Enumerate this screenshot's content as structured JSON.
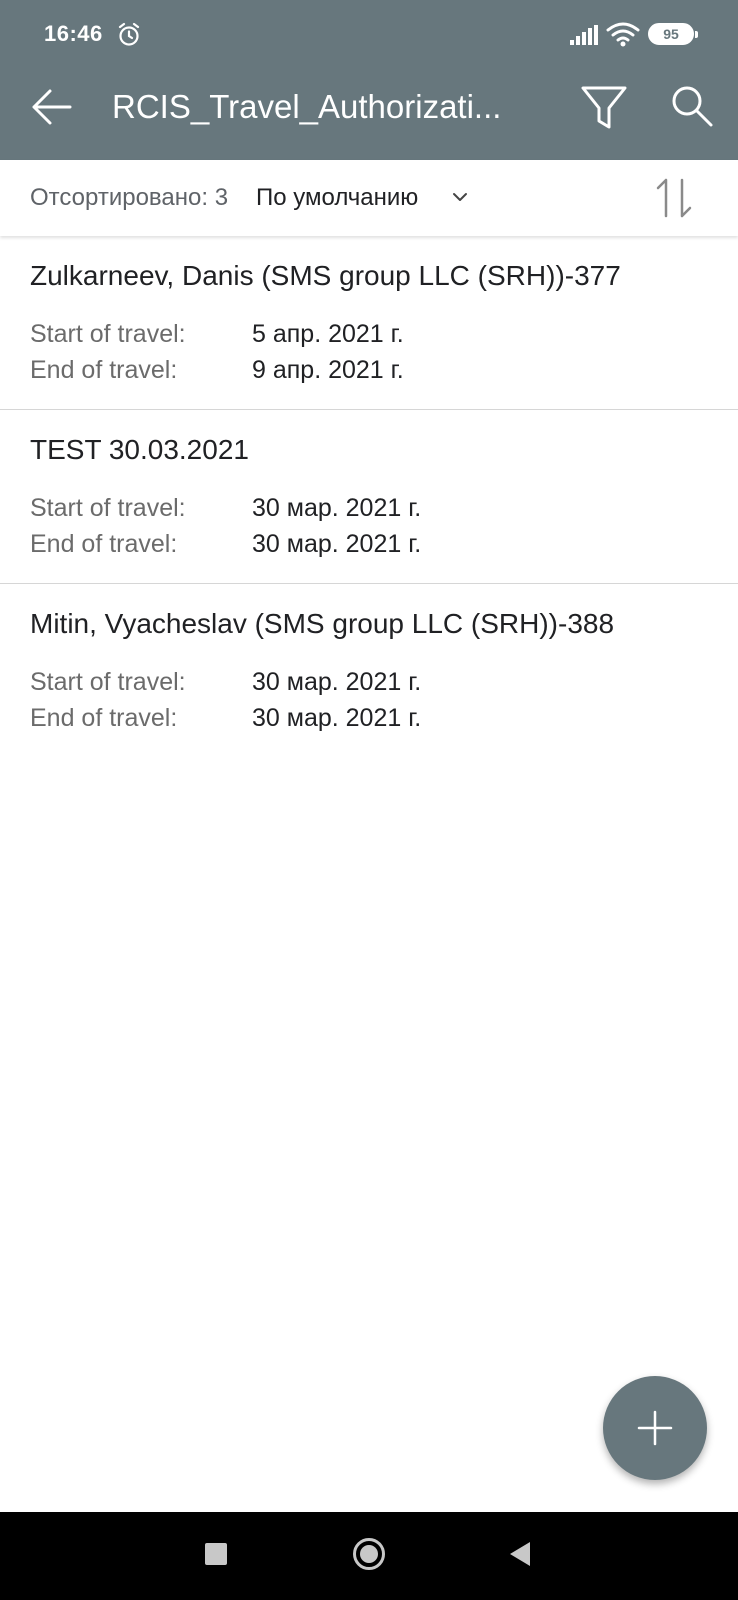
{
  "status_bar": {
    "time": "16:46",
    "battery": "95",
    "icons": [
      "alarm-icon",
      "signal-icon",
      "wifi-icon",
      "battery-icon"
    ]
  },
  "toolbar": {
    "title": "RCIS_Travel_Authorizati...",
    "icons": [
      "back-arrow-icon",
      "filter-icon",
      "search-icon"
    ]
  },
  "sort_bar": {
    "label": "Отсортировано: 3",
    "value": "По умолчанию",
    "icons": [
      "chevron-down-icon",
      "sort-order-icon"
    ]
  },
  "list": {
    "items": [
      {
        "title": "Zulkarneev, Danis (SMS group LLC (SRH))-377",
        "start_label": "Start of travel:",
        "start_value": "5 апр. 2021 г.",
        "end_label": "End of travel:",
        "end_value": "9 апр. 2021 г."
      },
      {
        "title": "TEST 30.03.2021",
        "start_label": "Start of travel:",
        "start_value": "30 мар. 2021 г.",
        "end_label": "End of travel:",
        "end_value": "30 мар. 2021 г."
      },
      {
        "title": "Mitin, Vyacheslav (SMS group LLC (SRH))-388",
        "start_label": "Start of travel:",
        "start_value": "30 мар. 2021 г.",
        "end_label": "End of travel:",
        "end_value": "30 мар. 2021 г."
      }
    ]
  },
  "fab": {
    "icon": "plus-icon"
  },
  "nav_bar": {
    "icons": [
      "recents-square-icon",
      "home-circle-icon",
      "back-triangle-icon"
    ]
  },
  "colors": {
    "primary": "#67777d",
    "text": "#202124",
    "secondary_text": "#6b6b6b",
    "divider": "#d6d6d6"
  }
}
